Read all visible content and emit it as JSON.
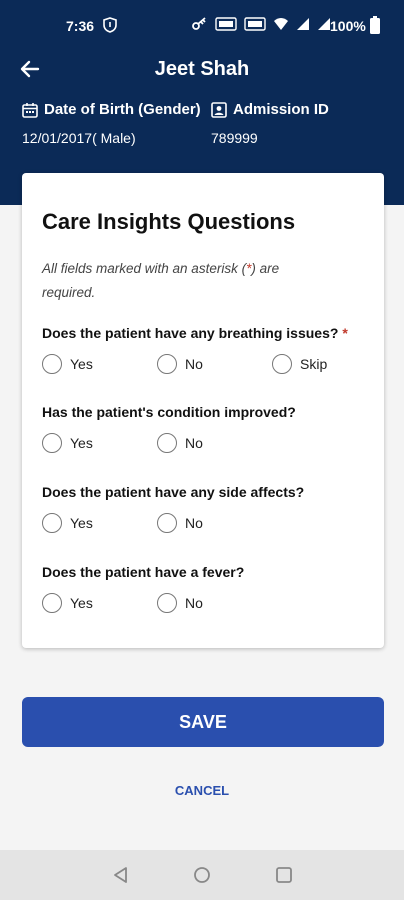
{
  "status_bar": {
    "time": "7:36",
    "battery": "100%"
  },
  "header": {
    "patient_name": "Jeet Shah",
    "dob_label": "Date of Birth (Gender)",
    "dob_value": "12/01/2017( Male)",
    "admission_label": "Admission ID",
    "admission_value": "789999"
  },
  "card": {
    "title": "Care Insights Questions",
    "note_before": "All fields marked with an asterisk (",
    "note_asterisk": "*",
    "note_after": ") are required.",
    "questions": [
      {
        "text": "Does the patient have any breathing issues?",
        "required_mark": "*",
        "options": [
          "Yes",
          "No",
          "Skip"
        ]
      },
      {
        "text": "Has the patient's condition improved?",
        "options": [
          "Yes",
          "No"
        ]
      },
      {
        "text": "Does the patient have any side affects?",
        "options": [
          "Yes",
          "No"
        ]
      },
      {
        "text": "Does the patient have a fever?",
        "options": [
          "Yes",
          "No"
        ]
      }
    ]
  },
  "actions": {
    "save_label": "SAVE",
    "cancel_label": "CANCEL"
  },
  "colors": {
    "header_bg": "#0b2a57",
    "primary": "#2a4fae",
    "required": "#c0392b"
  },
  "icons": {
    "back": "arrow-left-icon",
    "calendar": "calendar-icon",
    "id_badge": "id-badge-icon",
    "nav_back": "triangle-back-icon",
    "nav_home": "circle-home-icon",
    "nav_recents": "square-recents-icon"
  }
}
